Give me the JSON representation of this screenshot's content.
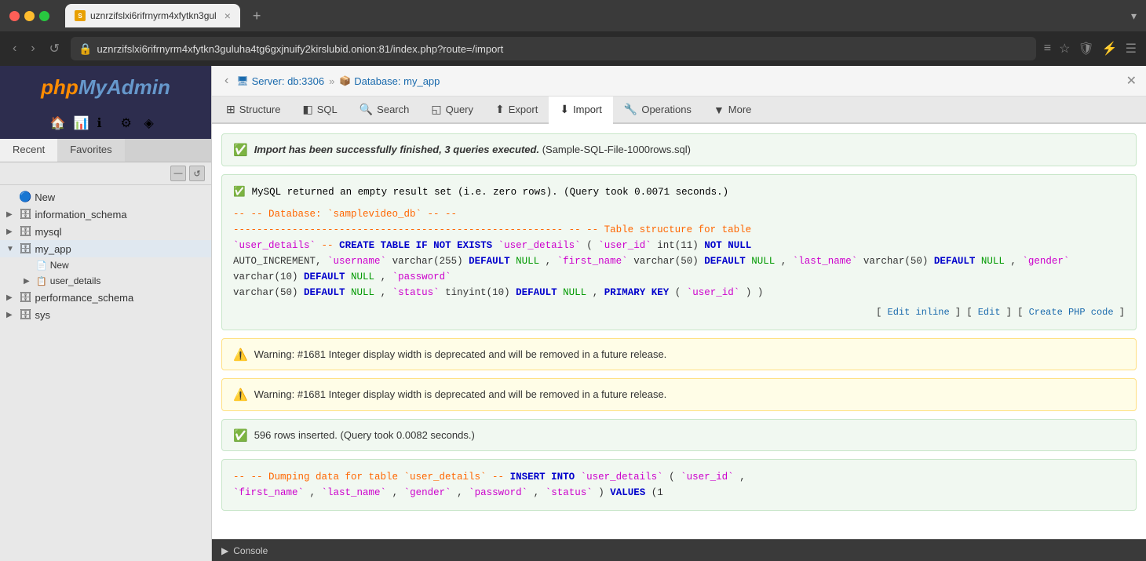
{
  "browser": {
    "tab_label": "uznrzifslxi6rifrnyrm4xfytkn3gul",
    "tab_close": "×",
    "tab_new": "+",
    "address": "uznrzifslxi6rifrnyrm4xfytkn3guluha4tg6gxjnuify2kirslubid.onion:81/index.php?route=/import",
    "tab_list": "▾"
  },
  "sidebar": {
    "logo_php": "php",
    "logo_my": "My",
    "logo_admin": "Admin",
    "tab_recent": "Recent",
    "tab_favorites": "Favorites",
    "databases": [
      {
        "name": "New",
        "expanded": false,
        "indent": 0,
        "type": "new"
      },
      {
        "name": "information_schema",
        "expanded": false,
        "indent": 0,
        "type": "db"
      },
      {
        "name": "mysql",
        "expanded": false,
        "indent": 0,
        "type": "db"
      },
      {
        "name": "my_app",
        "expanded": true,
        "indent": 0,
        "type": "db"
      },
      {
        "name": "New",
        "expanded": false,
        "indent": 1,
        "type": "new_table"
      },
      {
        "name": "user_details",
        "expanded": true,
        "indent": 1,
        "type": "table"
      },
      {
        "name": "performance_schema",
        "expanded": false,
        "indent": 0,
        "type": "db"
      },
      {
        "name": "sys",
        "expanded": false,
        "indent": 0,
        "type": "db"
      }
    ]
  },
  "breadcrumb": {
    "server": "Server: db:3306",
    "database": "Database: my_app"
  },
  "nav_tabs": [
    {
      "id": "structure",
      "label": "Structure",
      "icon": "⊞"
    },
    {
      "id": "sql",
      "label": "SQL",
      "icon": "◧"
    },
    {
      "id": "search",
      "label": "Search",
      "icon": "🔍"
    },
    {
      "id": "query",
      "label": "Query",
      "icon": "◱"
    },
    {
      "id": "export",
      "label": "Export",
      "icon": "⬆"
    },
    {
      "id": "import",
      "label": "Import",
      "icon": "⬇",
      "active": true
    },
    {
      "id": "operations",
      "label": "Operations",
      "icon": "🔧"
    },
    {
      "id": "more",
      "label": "More",
      "icon": "▼"
    }
  ],
  "messages": {
    "success1": {
      "type": "success",
      "text_bold": "Import has been successfully finished, 3 queries executed.",
      "text_normal": " (Sample-SQL-File-1000rows.sql)"
    },
    "success2": {
      "type": "success",
      "text": "MySQL returned an empty result set (i.e. zero rows). (Query took 0.0071 seconds.)"
    },
    "sql_block": {
      "line1_comment": "-- -- Database: `samplevideo_db` -- --",
      "line2_dashes": "-------------------------------------------------------- -- -- Table structure for table",
      "line3": "`user_details` -- CREATE TABLE IF NOT EXISTS `user_details` ( `user_id` int(11) NOT NULL AUTO_INCREMENT, `username` varchar(255) DEFAULT NULL, `first_name` varchar(50) DEFAULT NULL, `last_name` varchar(50) DEFAULT NULL, `gender` varchar(10) DEFAULT NULL, `password` varchar(50) DEFAULT NULL, `status` tinyint(10) DEFAULT NULL, PRIMARY KEY (`user_id`) )",
      "edit_inline": "Edit inline",
      "edit": "Edit",
      "create_php": "Create PHP code"
    },
    "warning1": "Warning: #1681 Integer display width is deprecated and will be removed in a future release.",
    "warning2": "Warning: #1681 Integer display width is deprecated and will be removed in a future release.",
    "success3": "596 rows inserted. (Query took 0.0082 seconds.)",
    "sql_dump_line": "-- -- Dumping data for table `user_details` -- INSERT INTO `user_details` (`user_id`,",
    "sql_dump_line2": "`first_name`, `last_name`, `gender`, `password`, `status`) VALUES (1"
  },
  "console": {
    "label": "Console"
  }
}
